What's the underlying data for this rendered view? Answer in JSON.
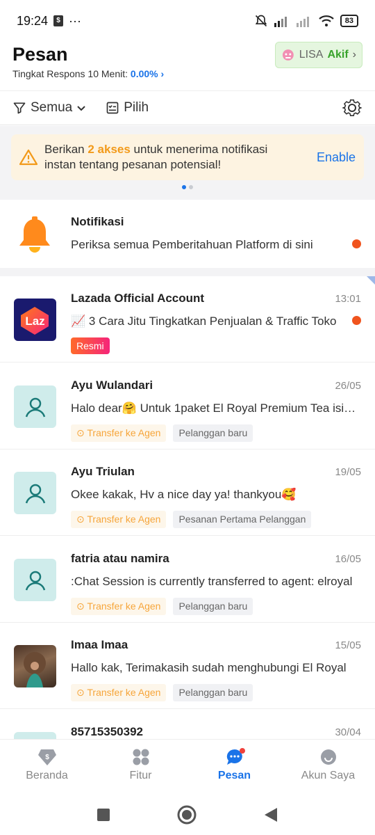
{
  "status_bar": {
    "time": "19:24",
    "more": "···",
    "battery": "83"
  },
  "header": {
    "title": "Pesan",
    "response_label": "Tingkat Respons 10 Menit:",
    "response_value": "0.00%",
    "agent_name": "LISA",
    "agent_status": "Akif"
  },
  "filters": {
    "all_label": "Semua",
    "select_label": "Pilih"
  },
  "banner": {
    "text_before": "Berikan ",
    "highlight": "2 akses",
    "text_after": " untuk menerima notifikasi instan tentang pesanan potensial!",
    "enable_label": "Enable"
  },
  "notification": {
    "title": "Notifikasi",
    "message": "Periksa semua Pemberitahuan Platform di sini"
  },
  "conversations": [
    {
      "name": "Lazada Official Account",
      "date": "13:01",
      "message": "📈 3 Cara Jitu Tingkatkan Penjualan & Traffic Toko",
      "tag1": "Resmi",
      "avatar": "laz-logo-icon",
      "unread": true
    },
    {
      "name": "Ayu Wulandari",
      "date": "26/05",
      "message": "Halo dear🤗  Untuk 1paket El Royal Premium Tea isinya",
      "tag1": "Transfer ke Agen",
      "tag2": "Pelanggan baru"
    },
    {
      "name": "Ayu Triulan",
      "date": "19/05",
      "message": "Okee kakak, Hv a nice day ya! thankyou🥰",
      "tag1": "Transfer ke Agen",
      "tag2": "Pesanan Pertama Pelanggan"
    },
    {
      "name": "fatria atau namira",
      "date": "16/05",
      "message": ":Chat Session is currently transferred to agent: elroyal",
      "tag1": "Transfer ke Agen",
      "tag2": "Pelanggan baru"
    },
    {
      "name": "Imaa Imaa",
      "date": "15/05",
      "message": "Hallo kak, Terimakasih sudah menghubungi El Royal",
      "tag1": "Transfer ke Agen",
      "tag2": "Pelanggan baru"
    },
    {
      "name": "85715350392",
      "date": "30/04"
    }
  ],
  "bottom_nav": {
    "home": "Beranda",
    "features": "Fitur",
    "messages": "Pesan",
    "account": "Akun Saya"
  },
  "colors": {
    "accent": "#1a73e8",
    "warning": "#f29a1a",
    "unread": "#f0541e",
    "online": "#38a32b"
  }
}
